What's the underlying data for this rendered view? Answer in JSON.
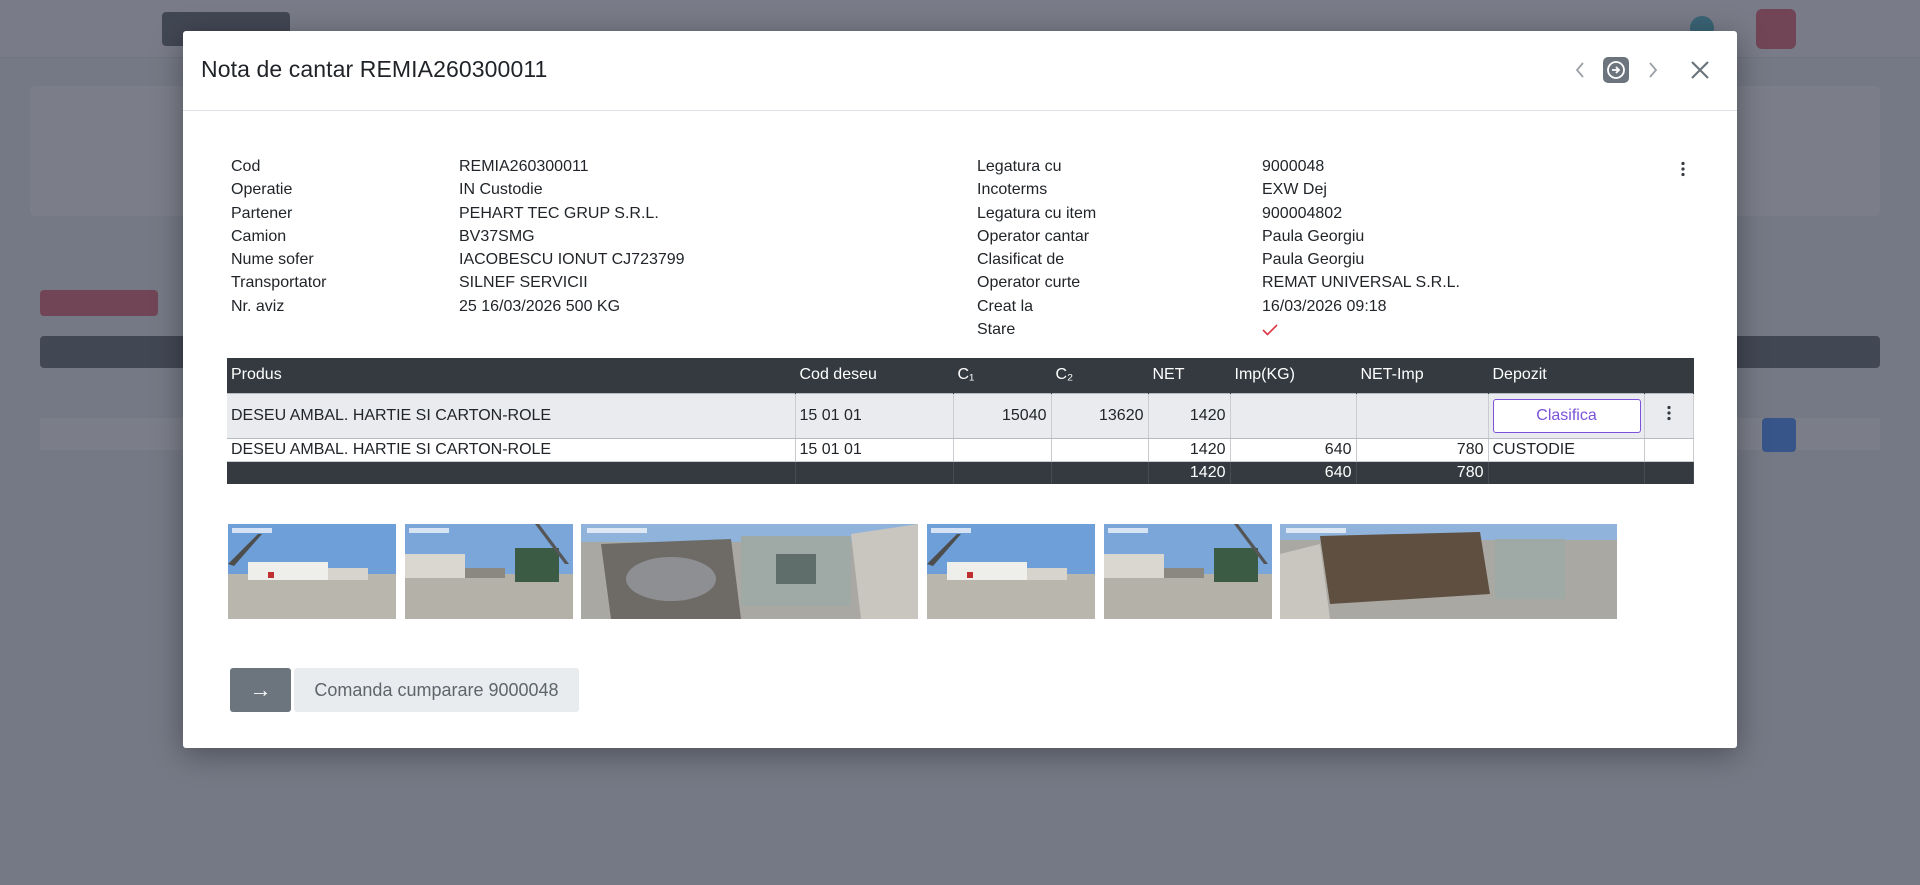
{
  "modal": {
    "title": "Nota de cantar REMIA260300011"
  },
  "info_left": [
    {
      "label": "Cod",
      "value": "REMIA260300011"
    },
    {
      "label": "Operatie",
      "value": "IN Custodie"
    },
    {
      "label": "Partener",
      "value": "PEHART TEC GRUP S.R.L."
    },
    {
      "label": "Camion",
      "value": "BV37SMG"
    },
    {
      "label": "Nume sofer",
      "value": "IACOBESCU IONUT CJ723799"
    },
    {
      "label": "Transportator",
      "value": "SILNEF SERVICII"
    },
    {
      "label": "Nr. aviz",
      "value": "25 16/03/2026 500 KG"
    }
  ],
  "info_right": [
    {
      "label": "Legatura cu",
      "value": "9000048"
    },
    {
      "label": "Incoterms",
      "value": "EXW Dej"
    },
    {
      "label": "Legatura cu item",
      "value": "900004802"
    },
    {
      "label": "Operator cantar",
      "value": "Paula Georgiu"
    },
    {
      "label": "Clasificat de",
      "value": "Paula Georgiu"
    },
    {
      "label": "Operator curte",
      "value": "REMAT UNIVERSAL S.R.L."
    },
    {
      "label": "Creat la",
      "value": "16/03/2026 09:18"
    },
    {
      "label": "Stare",
      "value": ""
    }
  ],
  "stare_icon": "checkmark-icon",
  "table": {
    "headers": [
      "Produs",
      "Cod deseu",
      "C₁",
      "C₂",
      "NET",
      "Imp(KG)",
      "NET-Imp",
      "Depozit",
      ""
    ],
    "rows": [
      {
        "produs": "DESEU AMBAL. HARTIE SI CARTON-ROLE",
        "cod": "15 01 01",
        "c1": "15040",
        "c2": "13620",
        "net": "1420",
        "imp": "",
        "netimp": "",
        "depozit": "",
        "button": "Clasifica"
      },
      {
        "produs": "DESEU AMBAL. HARTIE SI CARTON-ROLE",
        "cod": "15 01 01",
        "c1": "",
        "c2": "",
        "net": "1420",
        "imp": "640",
        "netimp": "780",
        "depozit": "CUSTODIE",
        "button": ""
      }
    ],
    "total": {
      "net": "1420",
      "imp": "640",
      "netimp": "780"
    }
  },
  "footer": {
    "arrow_label": "→",
    "order_label": "Comanda cumparare 9000048"
  },
  "colors": {
    "dark": "#343a40",
    "accent": "#7b52d9",
    "check": "#dc3545",
    "secondary": "#6c757d"
  }
}
